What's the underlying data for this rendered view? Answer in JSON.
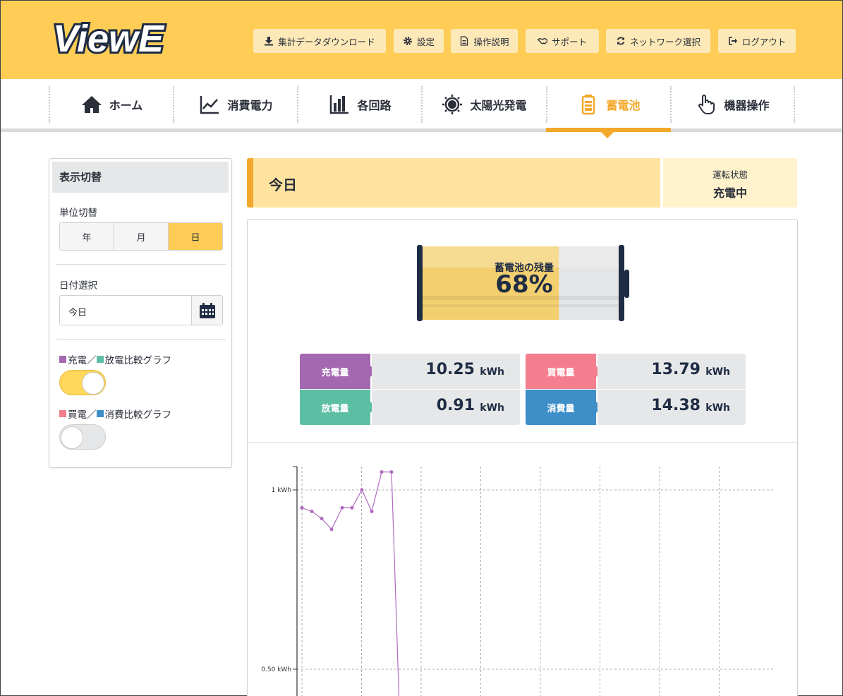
{
  "header": {
    "logo_text": "ViewE",
    "buttons": [
      {
        "label": "集計データダウンロード",
        "icon": "download-icon"
      },
      {
        "label": "設定",
        "icon": "gear-icon"
      },
      {
        "label": "操作説明",
        "icon": "document-icon"
      },
      {
        "label": "サポート",
        "icon": "handshake-icon"
      },
      {
        "label": "ネットワーク選択",
        "icon": "refresh-icon"
      },
      {
        "label": "ログアウト",
        "icon": "logout-icon"
      }
    ]
  },
  "nav": {
    "items": [
      {
        "label": "ホーム",
        "icon": "home-icon"
      },
      {
        "label": "消費電力",
        "icon": "line-chart-icon"
      },
      {
        "label": "各回路",
        "icon": "bar-chart-icon"
      },
      {
        "label": "太陽光発電",
        "icon": "sun-icon"
      },
      {
        "label": "蓄電池",
        "icon": "battery-icon"
      },
      {
        "label": "機器操作",
        "icon": "pointer-hand-icon"
      }
    ],
    "active_index": 4,
    "accent_color": "#f3a82b"
  },
  "sidebar": {
    "title": "表示切替",
    "unit_label": "単位切替",
    "units": [
      "年",
      "月",
      "日"
    ],
    "selected_unit": "日",
    "date_label": "日付選択",
    "date_value": "今日",
    "graph1_label_a": "充電",
    "graph1_sep": "／",
    "graph1_label_b": "放電比較グラフ",
    "graph1_on": true,
    "graph2_label_a": "買電",
    "graph2_sep": "／",
    "graph2_label_b": "消費比較グラフ",
    "graph2_on": false
  },
  "main": {
    "period_title": "今日",
    "status_label": "運転状態",
    "status_value": "充電中",
    "battery_label": "蓄電池の残量",
    "battery_percent_text": "68%",
    "battery_level": 0.68,
    "stats": [
      {
        "label": "充電量",
        "value": "10.25",
        "unit": "kWh",
        "color": "#a468b0"
      },
      {
        "label": "買電量",
        "value": "13.79",
        "unit": "kWh",
        "color": "#f47e8e"
      },
      {
        "label": "放電量",
        "value": "0.91",
        "unit": "kWh",
        "color": "#5cbea3"
      },
      {
        "label": "消費量",
        "value": "14.38",
        "unit": "kWh",
        "color": "#3e8fc8"
      }
    ]
  },
  "chart_data": {
    "type": "line",
    "y_tick_labels": [
      "1 kWh",
      "0.50 kWh"
    ],
    "y_ticks": [
      1.0,
      0.5
    ],
    "series": [
      {
        "color": "#b06bc0",
        "x": [
          0,
          1,
          2,
          3,
          4,
          5,
          6,
          7,
          8,
          9,
          10
        ],
        "values": [
          0.95,
          0.94,
          0.92,
          0.89,
          0.95,
          0.95,
          1.0,
          0.94,
          1.05,
          1.05,
          0.0
        ]
      }
    ],
    "x_gridlines": 8,
    "grid": true
  }
}
